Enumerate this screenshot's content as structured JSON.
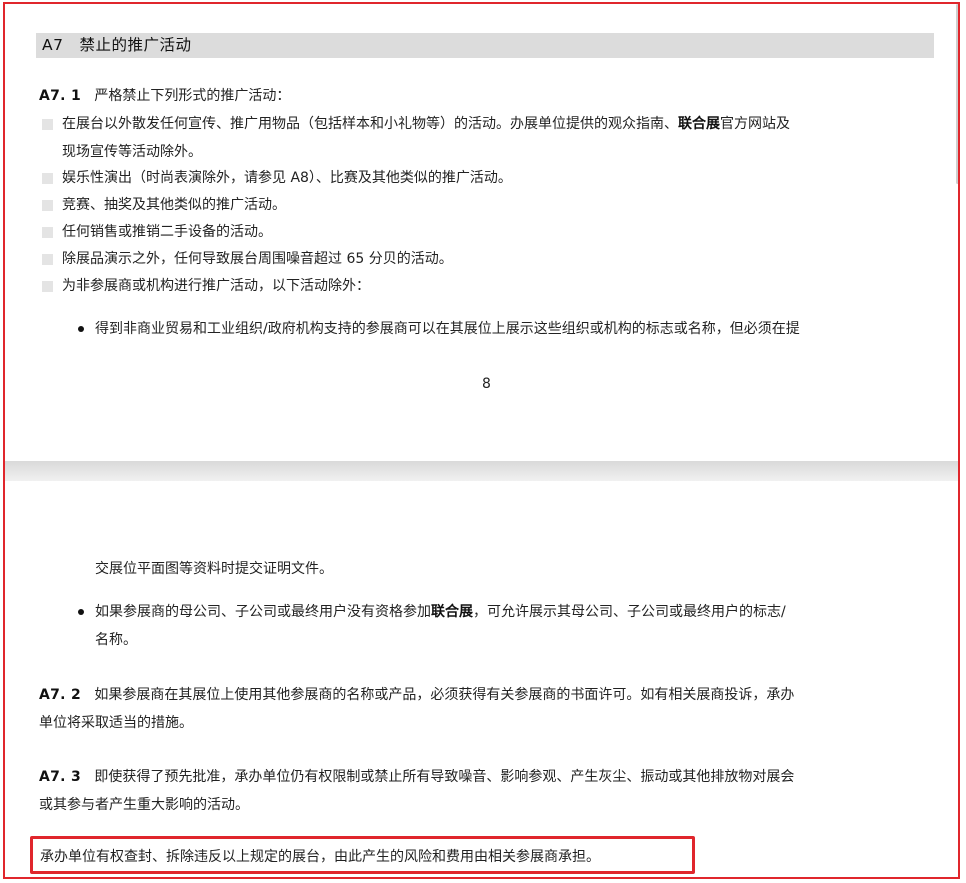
{
  "section": {
    "title": "A7　禁止的推广活动"
  },
  "a71": {
    "num": "A7. 1",
    "intro": "严格禁止下列形式的推广活动：",
    "items": [
      {
        "line1": "在展台以外散发任何宣传、推广用物品（包括样本和小礼物等）的活动。办展单位提供的观众指南、",
        "bold": "联合展",
        "line1_after": "官方网站及",
        "line2": "现场宣传等活动除外。"
      },
      {
        "text": "娱乐性演出（时尚表演除外，请参见 A8）、比赛及其他类似的推广活动。"
      },
      {
        "text": "竞赛、抽奖及其他类似的推广活动。"
      },
      {
        "text": "任何销售或推销二手设备的活动。"
      },
      {
        "text": "除展品演示之外，任何导致展台周围噪音超过 65 分贝的活动。"
      },
      {
        "text": "为非参展商或机构进行推广活动，以下活动除外："
      }
    ],
    "dots": [
      {
        "line1": "得到非商业贸易和工业组织/政府机构支持的参展商可以在其展位上展示这些组织或机构的标志或名称，但必须在提",
        "line2": "交展位平面图等资料时提交证明文件。"
      },
      {
        "line1_before": "如果参展商的母公司、子公司或最终用户没有资格参加",
        "bold": "联合展",
        "line1_after": "，可允许展示其母公司、子公司或最终用户的标志/",
        "line2": "名称。"
      }
    ]
  },
  "page_number": "8",
  "a72": {
    "num": "A7. 2",
    "line1": "如果参展商在其展位上使用其他参展商的名称或产品，必须获得有关参展商的书面许可。如有相关展商投诉，承办",
    "line2": "单位将采取适当的措施。"
  },
  "a73": {
    "num": "A7. 3",
    "line1": "即使获得了预先批准，承办单位仍有权限制或禁止所有导致噪音、影响参观、产生灰尘、振动或其他排放物对展会",
    "line2": "或其参与者产生重大影响的活动。"
  },
  "final_note": "承办单位有权查封、拆除违反以上规定的展台，由此产生的风险和费用由相关参展商承担。",
  "colors": {
    "highlight_border": "#e0262c",
    "section_bar": "#dcdcdc"
  }
}
